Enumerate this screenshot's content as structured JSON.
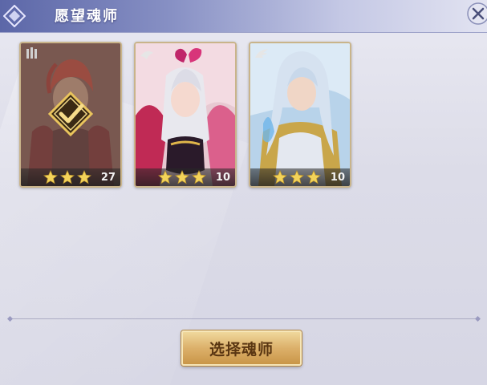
{
  "header": {
    "title": "愿望魂师"
  },
  "cards": [
    {
      "id": "card-1",
      "level": "27",
      "stars": 3,
      "selected": true
    },
    {
      "id": "card-2",
      "level": "10",
      "stars": 3,
      "selected": false
    },
    {
      "id": "card-3",
      "level": "10",
      "stars": 3,
      "selected": false
    }
  ],
  "actions": {
    "select_label": "选择魂师"
  },
  "colors": {
    "accent": "#dcb06a",
    "star": "#f3d35a",
    "header": "#5c67a8"
  }
}
